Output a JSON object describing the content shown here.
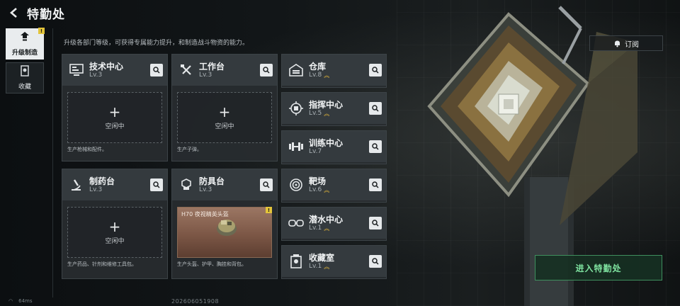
{
  "header": {
    "title": "特勤处"
  },
  "nav": {
    "items": [
      {
        "label": "升级制造",
        "active": true,
        "badge": "!"
      },
      {
        "label": "收藏",
        "active": false
      }
    ]
  },
  "subtitle": "升级各部门等级，可获得专属能力提升，和制造战斗物资的能力。",
  "workshops": [
    {
      "name": "技术中心",
      "level": "Lv.3",
      "slot_status": "空闲中",
      "desc": "生产枪械和配件。",
      "icon": "computer-icon"
    },
    {
      "name": "工作台",
      "level": "Lv.3",
      "slot_status": "空闲中",
      "desc": "生产子弹。",
      "icon": "tools-icon"
    },
    {
      "name": "制药台",
      "level": "Lv.3",
      "slot_status": "空闲中",
      "desc": "生产药品、针剂和维修工具包。",
      "icon": "microscope-icon"
    },
    {
      "name": "防具台",
      "level": "Lv.3",
      "item_name": "H70 夜视精英头盔",
      "item_badge": "!",
      "desc": "生产头盔、护甲、胸挂和背包。",
      "icon": "armor-icon"
    }
  ],
  "departments": [
    {
      "name": "仓库",
      "level": "Lv.8",
      "upgradable": true,
      "icon": "warehouse-icon"
    },
    {
      "name": "指挥中心",
      "level": "Lv.5",
      "upgradable": true,
      "icon": "chip-icon"
    },
    {
      "name": "训练中心",
      "level": "Lv.7",
      "upgradable": false,
      "icon": "dumbbell-icon"
    },
    {
      "name": "靶场",
      "level": "Lv.6",
      "upgradable": true,
      "icon": "target-icon"
    },
    {
      "name": "潜水中心",
      "level": "Lv.1",
      "upgradable": true,
      "icon": "diving-mask-icon"
    },
    {
      "name": "收藏室",
      "level": "Lv.1",
      "upgradable": true,
      "icon": "collection-icon"
    }
  ],
  "subscribe": {
    "label": "订阅"
  },
  "enter_button": {
    "label": "进入特勤处"
  },
  "status": {
    "ping": "64ms",
    "uid": "202606051908"
  },
  "colors": {
    "accent_green": "#7fe3a0",
    "upgrade_gold": "#e0b43a",
    "badge_yellow": "#e3c43a"
  }
}
